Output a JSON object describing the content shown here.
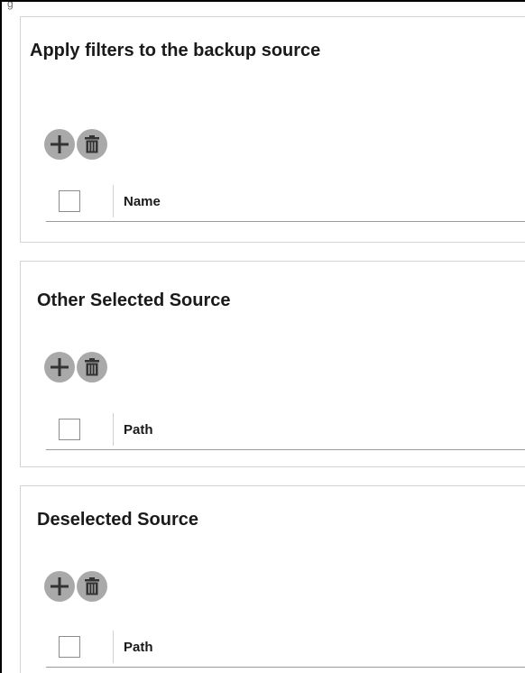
{
  "top_bar": {
    "text": "g"
  },
  "panels": [
    {
      "title": "Apply filters to the backup source",
      "add_icon": "plus-icon",
      "delete_icon": "trash-icon",
      "column_header": "Name"
    },
    {
      "title": "Other Selected Source",
      "add_icon": "plus-icon",
      "delete_icon": "trash-icon",
      "column_header": "Path"
    },
    {
      "title": "Deselected Source",
      "add_icon": "plus-icon",
      "delete_icon": "trash-icon",
      "column_header": "Path"
    }
  ],
  "colors": {
    "button_bg": "#a9a9a9",
    "icon": "#333333",
    "panel_border": "#d4d4d4"
  }
}
